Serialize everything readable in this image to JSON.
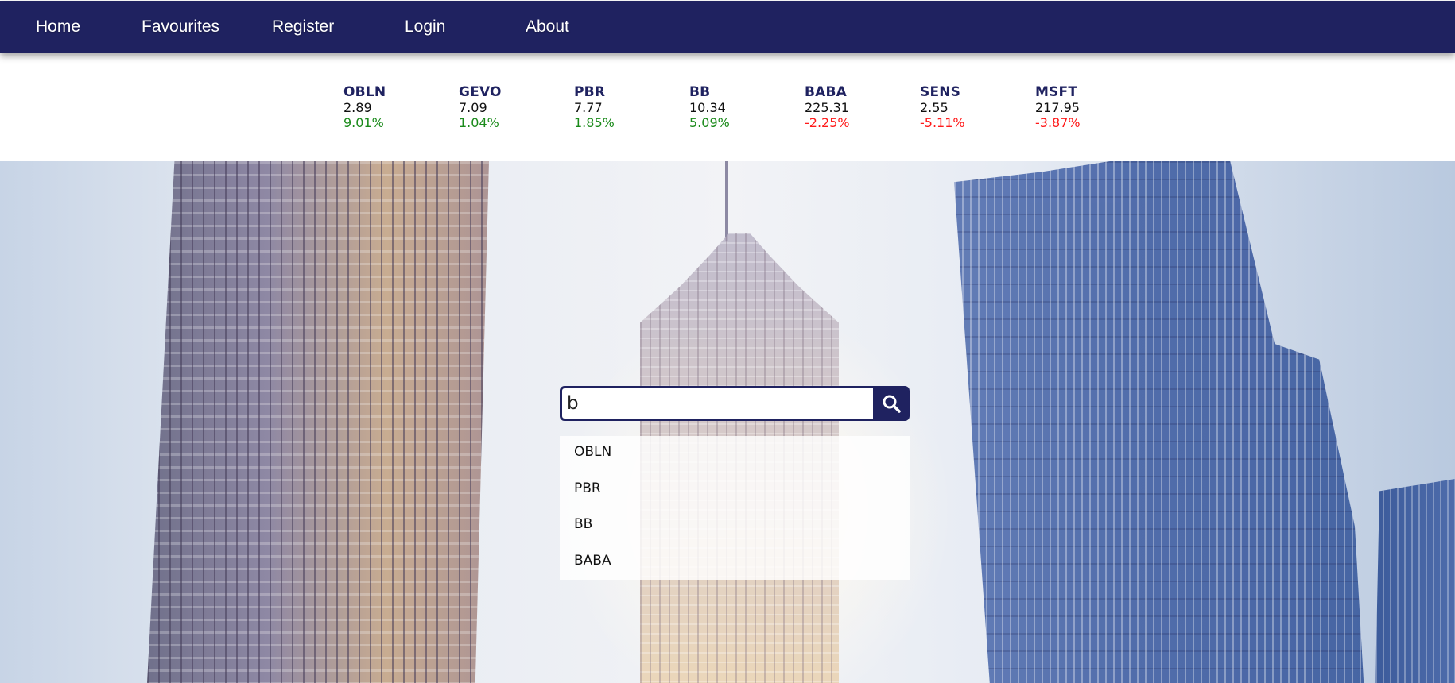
{
  "nav": {
    "items": [
      {
        "label": "Home"
      },
      {
        "label": "Favourites"
      },
      {
        "label": "Register"
      },
      {
        "label": "Login"
      },
      {
        "label": "About"
      }
    ]
  },
  "ticker": [
    {
      "symbol": "OBLN",
      "price": "2.89",
      "change": "9.01%",
      "trend": "up"
    },
    {
      "symbol": "GEVO",
      "price": "7.09",
      "change": "1.04%",
      "trend": "up"
    },
    {
      "symbol": "PBR",
      "price": "7.77",
      "change": "1.85%",
      "trend": "up"
    },
    {
      "symbol": "BB",
      "price": "10.34",
      "change": "5.09%",
      "trend": "up"
    },
    {
      "symbol": "BABA",
      "price": "225.31",
      "change": "-2.25%",
      "trend": "down"
    },
    {
      "symbol": "SENS",
      "price": "2.55",
      "change": "-5.11%",
      "trend": "down"
    },
    {
      "symbol": "MSFT",
      "price": "217.95",
      "change": "-3.87%",
      "trend": "down"
    }
  ],
  "search": {
    "value": "b",
    "button_icon": "search-icon",
    "suggestions": [
      "OBLN",
      "PBR",
      "BB",
      "BABA"
    ]
  },
  "colors": {
    "brand": "#1f2260",
    "up": "#1a8a1a",
    "down": "#ff1a1a"
  }
}
